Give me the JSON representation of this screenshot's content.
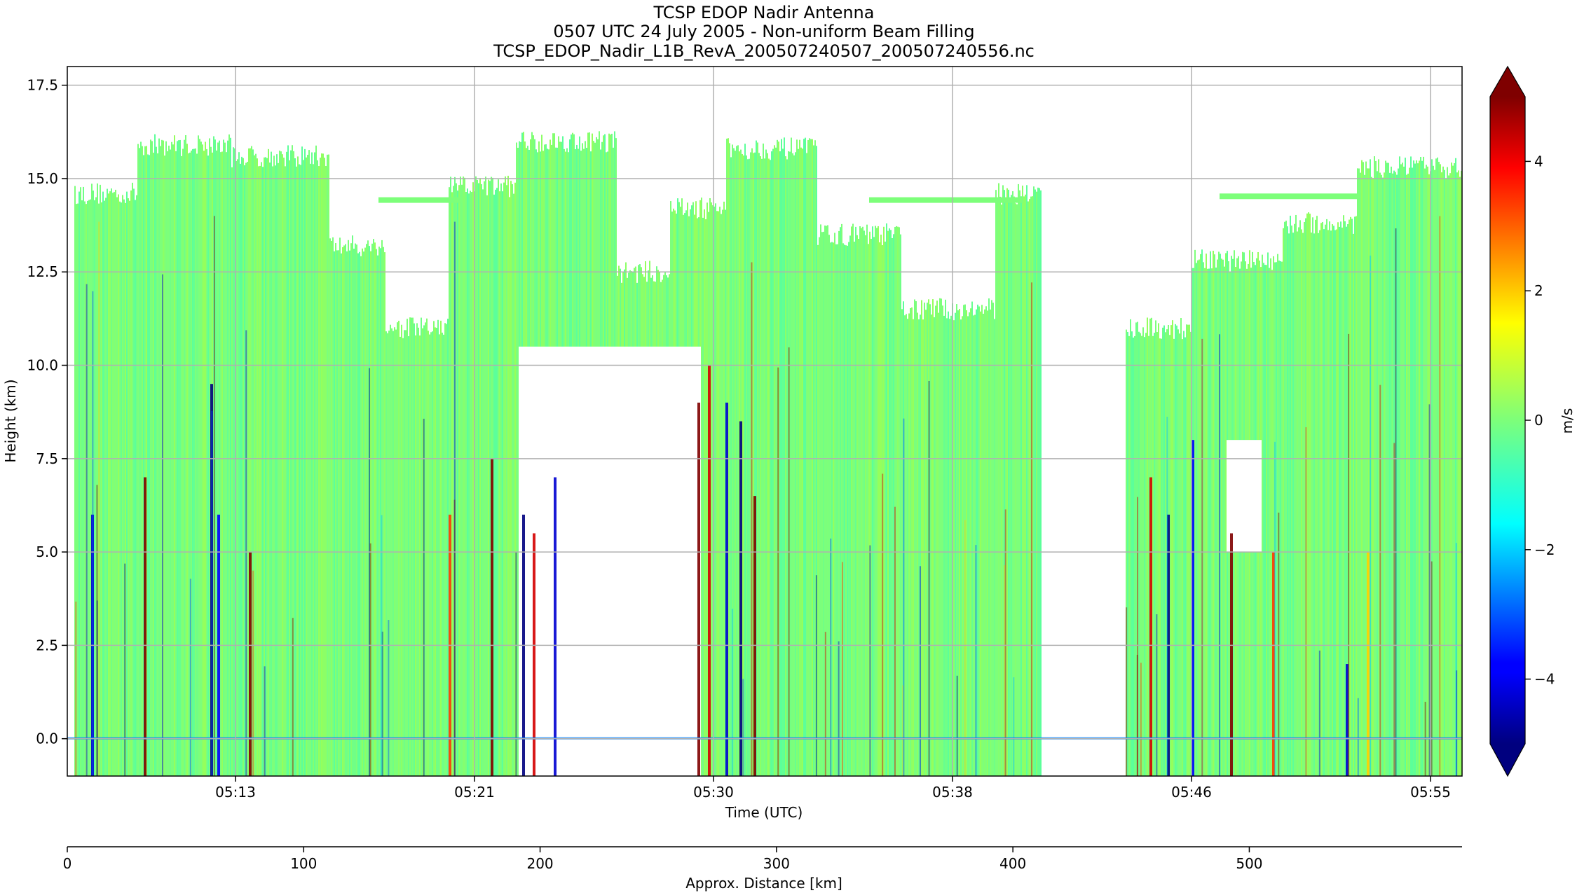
{
  "chart_data": {
    "type": "heatmap",
    "title_lines": [
      "TCSP EDOP Nadir Antenna",
      "0507 UTC 24 July 2005 - Non-uniform Beam Filling",
      "TCSP_EDOP_Nadir_L1B_RevA_200507240507_200507240556.nc"
    ],
    "xlabel": "Time (UTC)",
    "ylabel": "Height (km)",
    "x_ticks": [
      "05:13",
      "05:21",
      "05:30",
      "05:38",
      "05:46",
      "05:55"
    ],
    "y_ticks": [
      "0.0",
      "2.5",
      "5.0",
      "7.5",
      "10.0",
      "12.5",
      "15.0",
      "17.5"
    ],
    "ylim": [
      -1.0,
      18.0
    ],
    "grid": true,
    "secondary_xlabel": "Approx. Distance [km]",
    "secondary_x_ticks": [
      "0",
      "100",
      "200",
      "300",
      "400",
      "500"
    ],
    "secondary_xlim": [
      0,
      590
    ],
    "colorbar": {
      "label": "m/s",
      "ticks": [
        "−4",
        "−2",
        "0",
        "2",
        "4"
      ],
      "range": [
        -5,
        5
      ],
      "colormap": "jet",
      "extend": "both"
    },
    "field": "Doppler velocity; dominant values near 0 m/s (green) with narrow vertical streaks of ±4–5 m/s"
  }
}
